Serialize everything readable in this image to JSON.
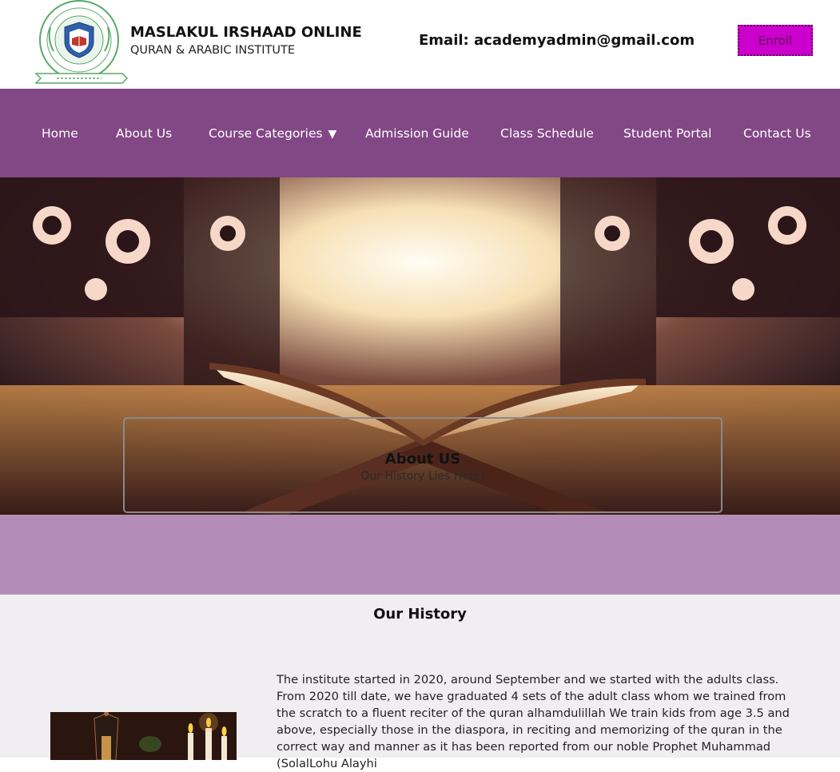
{
  "header": {
    "logo_icon": "institute-seal-logo",
    "brand_name": "MASLAKUL IRSHAAD ONLINE",
    "brand_subtitle": "QURAN & ARABIC INSTITUTE",
    "email_text": "Email: academyadmin@gmail.com",
    "enroll_label": "Enroll"
  },
  "nav": {
    "items": [
      {
        "label": "Home"
      },
      {
        "label": "About Us"
      },
      {
        "label": "Course Categories",
        "caret": "▼"
      },
      {
        "label": "Admission Guide"
      },
      {
        "label": "Class Schedule"
      },
      {
        "label": "Student Portal"
      },
      {
        "label": "Contact Us"
      }
    ]
  },
  "hero": {
    "title": "About US",
    "subtitle": "Our History Lies Here!"
  },
  "history": {
    "title": "Our History",
    "body": "The institute started in 2020, around September and we started with the adults class. From 2020 till date, we have graduated 4 sets of the adult class whom we trained from the scratch to a fluent reciter of the quran alhamdulillah We train kids from age 3.5 and above, especially those in the diaspora, in reciting and memorizing of the quran in the correct way and manner as it has been reported from our noble Prophet Muhammad (SolalLohu Alayhi"
  },
  "colors": {
    "nav_bg": "#824785",
    "band_bg": "#b48db6",
    "section_bg": "#f1eef2",
    "enroll_bg": "#cc00cc"
  }
}
